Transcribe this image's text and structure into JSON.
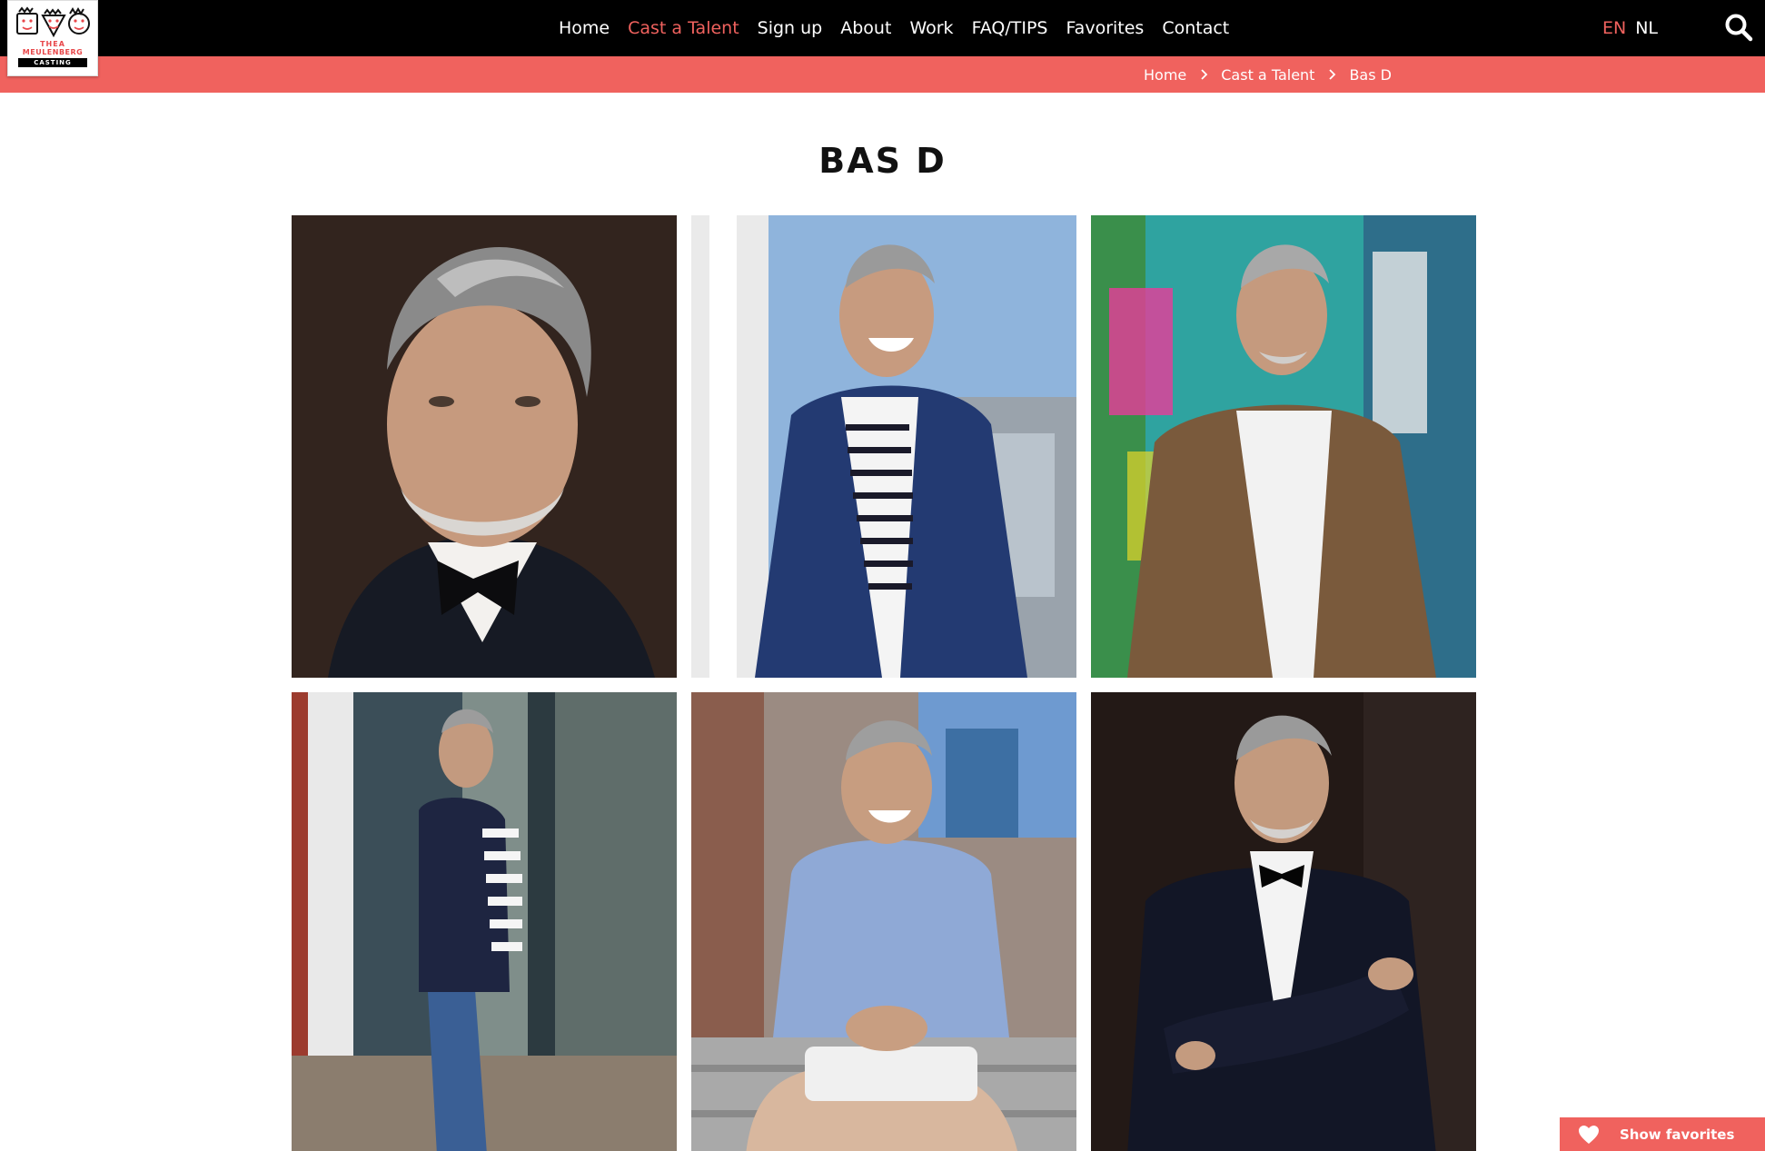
{
  "brand": {
    "logo_line1": "THEA",
    "logo_line2": "MEULENBERG",
    "logo_line3": "CASTING"
  },
  "nav": {
    "items": [
      {
        "label": "Home",
        "active": false
      },
      {
        "label": "Cast a Talent",
        "active": true
      },
      {
        "label": "Sign up",
        "active": false
      },
      {
        "label": "About",
        "active": false
      },
      {
        "label": "Work",
        "active": false
      },
      {
        "label": "FAQ/TIPS",
        "active": false
      },
      {
        "label": "Favorites",
        "active": false
      },
      {
        "label": "Contact",
        "active": false
      }
    ],
    "languages": [
      {
        "label": "EN",
        "active": true
      },
      {
        "label": "NL",
        "active": false
      }
    ],
    "search_icon": "search-icon"
  },
  "breadcrumb": {
    "items": [
      "Home",
      "Cast a Talent",
      "Bas D"
    ]
  },
  "page": {
    "title": "BAS D"
  },
  "gallery": {
    "photos": [
      {
        "name": "photo-portrait-tuxedo"
      },
      {
        "name": "photo-navy-jacket"
      },
      {
        "name": "photo-leather-jacket"
      },
      {
        "name": "photo-bodywarmer"
      },
      {
        "name": "photo-blue-shirt"
      },
      {
        "name": "photo-tuxedo-arms-crossed"
      }
    ]
  },
  "favorites": {
    "label": "Show favorites",
    "icon": "heart-icon"
  },
  "colors": {
    "accent": "#f0625e",
    "nav_bg": "#000000"
  }
}
